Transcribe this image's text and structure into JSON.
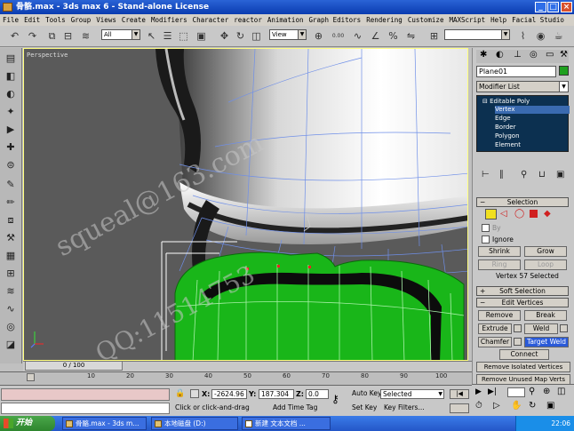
{
  "window": {
    "title": "骨骼.max - 3ds max 6 - Stand-alone License",
    "minimize": "_",
    "maximize": "□",
    "close": "×"
  },
  "menu": [
    "File",
    "Edit",
    "Tools",
    "Group",
    "Views",
    "Create",
    "Modifiers",
    "Character",
    "reactor",
    "Animation",
    "Graph Editors",
    "Rendering",
    "Customize",
    "MAXScript",
    "Help",
    "Facial Studio"
  ],
  "toolbar": {
    "selection_filter": "All",
    "ref_coord": "View",
    "spinner_value": "0.00",
    "icons": [
      "undo-icon",
      "redo-icon",
      "link-icon",
      "unlink-icon",
      "bind-space-warp-icon",
      "select-icon",
      "select-by-name-icon",
      "region-select-icon",
      "move-icon",
      "rotate-icon",
      "scale-icon",
      "pivot-icon",
      "snap-icon",
      "angle-snap-icon",
      "percent-snap-icon",
      "mirror-icon",
      "align-icon",
      "curve-editor-icon",
      "material-editor-icon",
      "render-icon"
    ]
  },
  "viewport": {
    "label": "Perspective",
    "watermark": "squeal@163.com",
    "watermark2": "QQ:11514753"
  },
  "command_panel": {
    "object_name": "Plane01",
    "object_color": "#1fa01f",
    "modifier_list": "Modifier List",
    "stack": [
      "Editable Poly",
      "Vertex",
      "Edge",
      "Border",
      "Polygon",
      "Element"
    ],
    "stack_selected": "Vertex",
    "selection": {
      "header": "Selection",
      "by": "By",
      "ignore": "Ignore",
      "shrink": "Shrink",
      "grow": "Grow",
      "ring": "Ring",
      "loop": "Loop",
      "status": "Vertex 57 Selected"
    },
    "soft_selection": "Soft Selection",
    "edit_vertices": {
      "header": "Edit Vertices",
      "remove": "Remove",
      "break": "Break",
      "extrude": "Extrude",
      "weld": "Weld",
      "chamfer": "Chamfer",
      "target_weld": "Target Weld",
      "connect": "Connect",
      "remove_isolated": "Remove Isolated Vertices",
      "remove_unused": "Remove Unused Map Verts"
    }
  },
  "timeline": {
    "slider_label": "0 / 100",
    "ticks": [
      "10",
      "20",
      "30",
      "40",
      "50",
      "60",
      "70",
      "80",
      "90",
      "100"
    ]
  },
  "status": {
    "x_label": "X:",
    "x_value": "-2624.96",
    "y_label": "Y:",
    "y_value": "187.304",
    "z_label": "Z:",
    "z_value": "0.0",
    "auto_key": "Auto Key",
    "selected": "Selected",
    "set_key": "Set Key",
    "key_filters": "Key Filters...",
    "prompt": "Click or click-and-drag",
    "add_time_tag": "Add Time Tag"
  },
  "taskbar": {
    "start": "开始",
    "tasks": [
      "骨骼.max - 3ds m...",
      "本地磁盘 (D:)",
      "新建 文本文档 ..."
    ],
    "clock": "22:06"
  }
}
